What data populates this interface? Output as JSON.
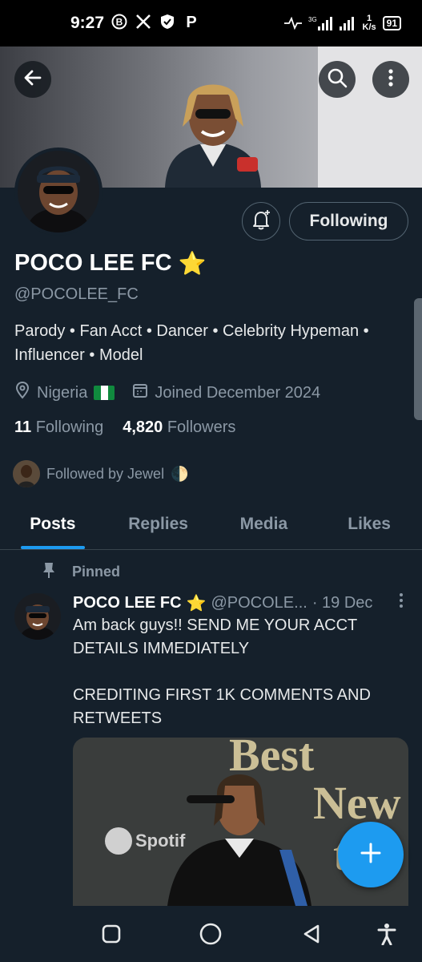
{
  "status_bar": {
    "time": "9:27",
    "left_icons": [
      "bitcoin-icon",
      "x-logo-icon",
      "shield-icon",
      "p-app-icon"
    ],
    "network_label": "3G",
    "speed_value": "1",
    "speed_unit": "K/s",
    "battery": "91"
  },
  "banner": {
    "back_icon": "arrow-left-icon",
    "search_icon": "search-icon",
    "more_icon": "more-vertical-icon"
  },
  "profile": {
    "name": "POCO LEE FC",
    "name_badge": "⭐",
    "handle": "@POCOLEE_FC",
    "bio": "Parody • Fan Acct • Dancer • Celebrity Hypeman • Influencer • Model",
    "location": "Nigeria",
    "joined": "Joined December 2024",
    "following_count": "11",
    "following_label": "Following",
    "followers_count": "4,820",
    "followers_label": "Followers",
    "followed_by": "Followed by Jewel",
    "followed_by_emoji": "🌓"
  },
  "actions": {
    "notify_icon": "bell-plus-icon",
    "following_button": "Following"
  },
  "tabs": [
    {
      "label": "Posts",
      "active": true
    },
    {
      "label": "Replies",
      "active": false
    },
    {
      "label": "Media",
      "active": false
    },
    {
      "label": "Likes",
      "active": false
    }
  ],
  "post": {
    "pinned_label": "Pinned",
    "author_name": "POCO LEE FC",
    "author_badge": "⭐",
    "author_handle": "@POCOLE...",
    "date": "· 19 Dec",
    "text_line1": "Am back guys!! SEND ME YOUR ACCT DETAILS IMMEDIATELY",
    "text_line2": "CREDITING FIRST 1K COMMENTS AND RETWEETS",
    "image_text": {
      "best": "Best",
      "new": "New",
      "tist": "tist",
      "spotify": "Spotif"
    }
  },
  "fab_icon": "plus-icon",
  "nav": [
    "recents-square-icon",
    "home-circle-icon",
    "back-triangle-icon",
    "accessibility-icon"
  ],
  "colors": {
    "background": "#15202b",
    "accent": "#1d9bf0",
    "muted_text": "#8b98a5",
    "border": "#536471"
  }
}
